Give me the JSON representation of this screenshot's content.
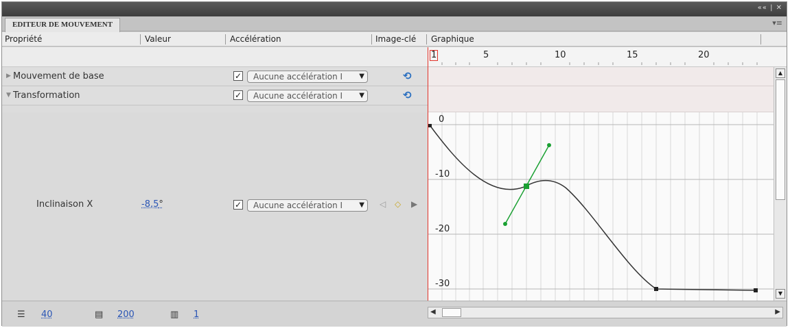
{
  "window": {
    "controls": "«« | ✕"
  },
  "tab": {
    "title": "EDITEUR DE MOUVEMENT",
    "menu": "▾≡"
  },
  "columns": {
    "property": "Propriété",
    "value": "Valeur",
    "easing": "Accélération",
    "keyframe": "Image-clé",
    "graph": "Graphique"
  },
  "ruler": {
    "ticks": [
      "1",
      "5",
      "10",
      "15",
      "20"
    ]
  },
  "rows": [
    {
      "label": "Mouvement de base",
      "expanded": false,
      "checked": true,
      "easing": "Aucune accélération I"
    },
    {
      "label": "Transformation",
      "expanded": true,
      "checked": true,
      "easing": "Aucune accélération I"
    }
  ],
  "property": {
    "label": "Inclinaison X",
    "value": "-8,5",
    "unit": "°",
    "checked": true,
    "easing": "Aucune accélération I"
  },
  "graph": {
    "y_labels": [
      "0",
      "-10",
      "-20",
      "-30"
    ]
  },
  "footer": {
    "graph_size": "40",
    "expanded_graph_size": "200",
    "visible_frames": "1"
  },
  "icons": {
    "reset": "reset-arrows-icon",
    "prev": "prev-keyframe-icon",
    "add": "add-keyframe-icon",
    "next": "next-keyframe-icon"
  },
  "colors": {
    "playhead": "#e2332a",
    "curve": "#333333",
    "handle": "#1aa032",
    "link": "#2a55b5"
  }
}
